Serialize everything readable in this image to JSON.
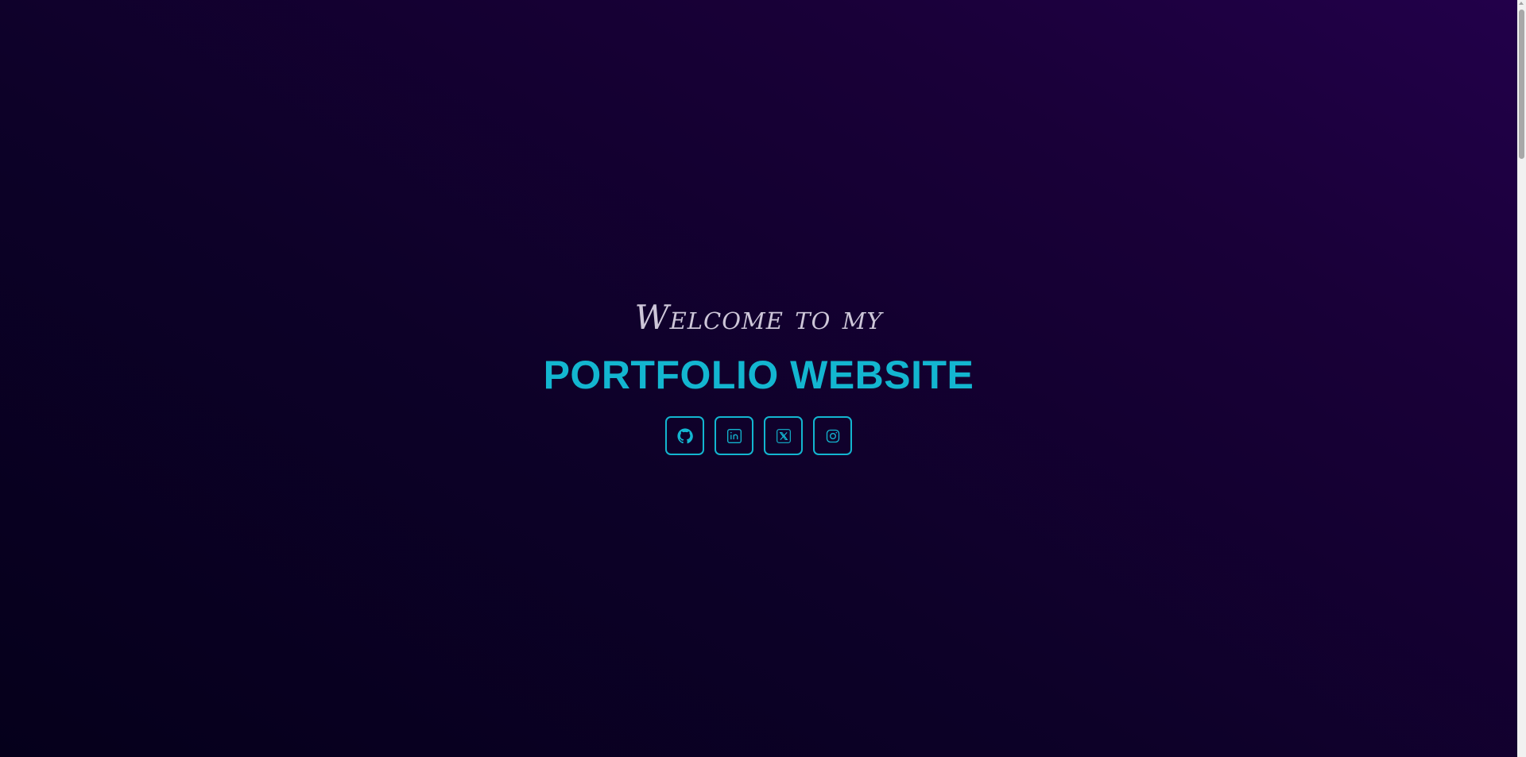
{
  "hero": {
    "welcome_text": "Welcome to my",
    "title_text": "PORTFOLIO WEBSITE"
  },
  "socials": [
    {
      "name": "github",
      "icon": "github-icon"
    },
    {
      "name": "linkedin",
      "icon": "linkedin-icon"
    },
    {
      "name": "x",
      "icon": "x-icon"
    },
    {
      "name": "instagram",
      "icon": "instagram-icon"
    }
  ],
  "colors": {
    "accent": "#13b6d0",
    "welcome_text": "#cdc6d8",
    "background_dark": "#05001b",
    "background_light": "#22004a"
  }
}
